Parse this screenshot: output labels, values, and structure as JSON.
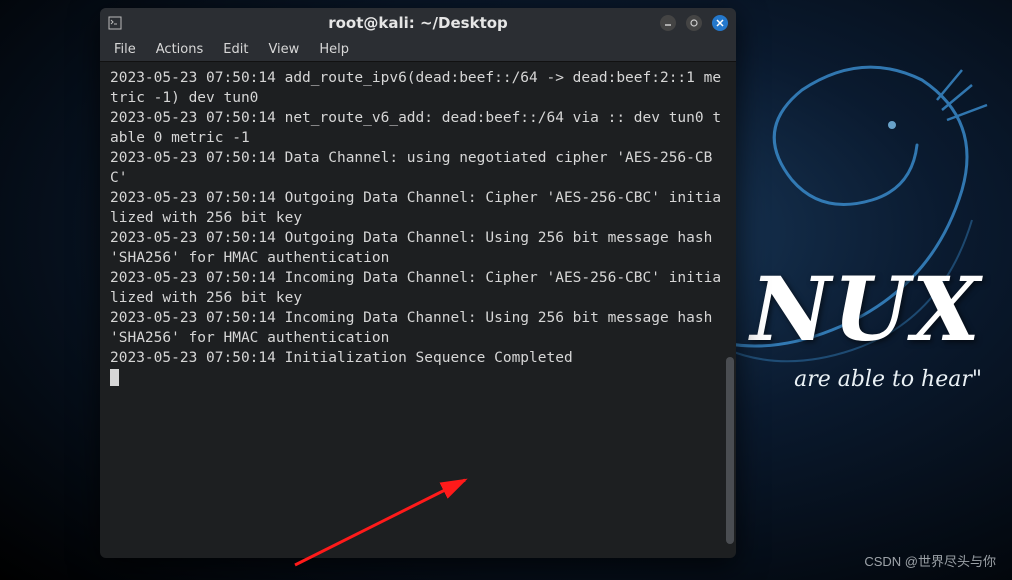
{
  "desktop": {
    "big_text": "NUX",
    "tagline": "are able to hear\""
  },
  "window": {
    "title": "root@kali: ~/Desktop",
    "menus": [
      "File",
      "Actions",
      "Edit",
      "View",
      "Help"
    ]
  },
  "terminal_output": "2023-05-23 07:50:14 add_route_ipv6(dead:beef::/64 -> dead:beef:2::1 metric -1) dev tun0\n2023-05-23 07:50:14 net_route_v6_add: dead:beef::/64 via :: dev tun0 table 0 metric -1\n2023-05-23 07:50:14 Data Channel: using negotiated cipher 'AES-256-CBC'\n2023-05-23 07:50:14 Outgoing Data Channel: Cipher 'AES-256-CBC' initialized with 256 bit key\n2023-05-23 07:50:14 Outgoing Data Channel: Using 256 bit message hash 'SHA256' for HMAC authentication\n2023-05-23 07:50:14 Incoming Data Channel: Cipher 'AES-256-CBC' initialized with 256 bit key\n2023-05-23 07:50:14 Incoming Data Channel: Using 256 bit message hash 'SHA256' for HMAC authentication\n2023-05-23 07:50:14 Initialization Sequence Completed",
  "watermark": "CSDN @世界尽头与你"
}
